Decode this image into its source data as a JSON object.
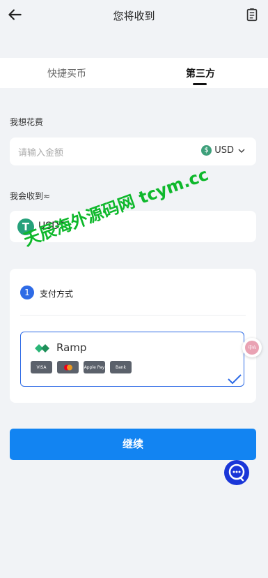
{
  "header": {
    "title": "您将收到"
  },
  "tabs": [
    {
      "label": "快捷买币"
    },
    {
      "label": "第三方"
    }
  ],
  "spend": {
    "label": "我想花费",
    "placeholder": "请输入金额",
    "currency": "USD"
  },
  "receive": {
    "label": "我会收到≈",
    "asset": "USDT"
  },
  "payment": {
    "step": "1",
    "title": "支付方式",
    "provider": "Ramp",
    "methods": [
      "VISA",
      "Mastercard",
      "Apple Pay",
      "Bank"
    ]
  },
  "continue_label": "继续",
  "watermark": "天辰海外源码网 tcym.cc",
  "colors": {
    "accent": "#2e6be6",
    "button": "#1284f2",
    "usdt": "#26a17b",
    "watermark": "#0eb82b"
  }
}
